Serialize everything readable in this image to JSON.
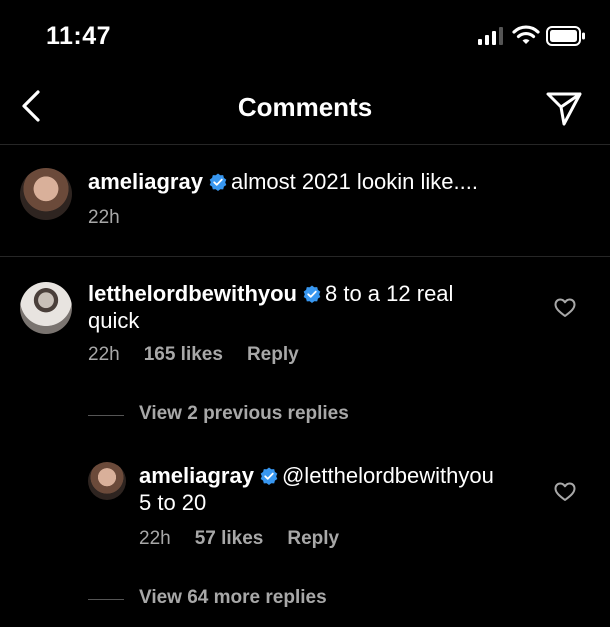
{
  "status_bar": {
    "time": "11:47"
  },
  "header": {
    "title": "Comments"
  },
  "caption": {
    "username": "ameliagray",
    "text": "almost 2021 lookin like....",
    "time": "22h"
  },
  "comment": {
    "username": "letthelordbewithyou",
    "text_line1": "8 to a 12 real",
    "text_line2": "quick",
    "time": "22h",
    "likes": "165 likes",
    "reply_label": "Reply"
  },
  "view_previous": "View 2 previous replies",
  "reply": {
    "username": "ameliagray",
    "mention": "@letthelordbewithyou",
    "text": "5 to 20",
    "time": "22h",
    "likes": "57 likes",
    "reply_label": "Reply"
  },
  "view_more": "View 64 more replies",
  "colors": {
    "verified": "#3897f0",
    "secondary_text": "#a8a8a8"
  },
  "icons": [
    "signal-icon",
    "wifi-icon",
    "battery-icon",
    "back-icon",
    "send-icon",
    "verified-icon",
    "heart-icon"
  ]
}
